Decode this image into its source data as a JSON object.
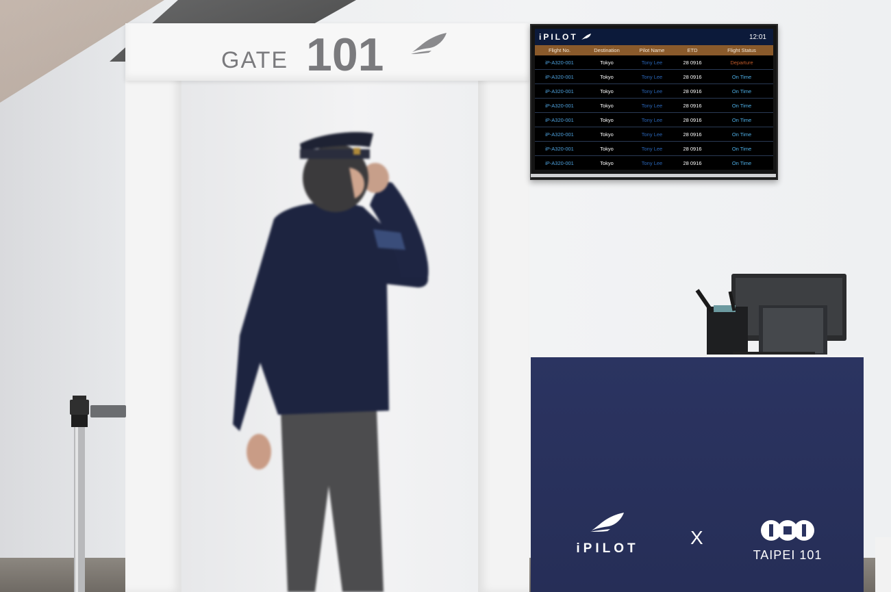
{
  "gate": {
    "word": "GATE",
    "number": "101"
  },
  "board": {
    "brand": "iPILOT",
    "time": "12:01",
    "columns": [
      "Flight No.",
      "Destination",
      "Pilot Name",
      "ETD",
      "Flight Status"
    ],
    "rows": [
      {
        "flight": "iP-A320-001",
        "dest": "Tokyo",
        "pilot": "Tony Lee",
        "etd": "28 0916",
        "status": "Departure"
      },
      {
        "flight": "iP-A320-001",
        "dest": "Tokyo",
        "pilot": "Tony Lee",
        "etd": "28 0916",
        "status": "On Time"
      },
      {
        "flight": "iP-A320-001",
        "dest": "Tokyo",
        "pilot": "Tony Lee",
        "etd": "28 0916",
        "status": "On Time"
      },
      {
        "flight": "iP-A320-001",
        "dest": "Tokyo",
        "pilot": "Tony Lee",
        "etd": "28 0916",
        "status": "On Time"
      },
      {
        "flight": "iP-A320-001",
        "dest": "Tokyo",
        "pilot": "Tony Lee",
        "etd": "28 0916",
        "status": "On Time"
      },
      {
        "flight": "iP-A320-001",
        "dest": "Tokyo",
        "pilot": "Tony Lee",
        "etd": "28 0916",
        "status": "On Time"
      },
      {
        "flight": "iP-A320-001",
        "dest": "Tokyo",
        "pilot": "Tony Lee",
        "etd": "28 0916",
        "status": "On Time"
      },
      {
        "flight": "iP-A320-001",
        "dest": "Tokyo",
        "pilot": "Tony Lee",
        "etd": "28 0916",
        "status": "On Time"
      }
    ]
  },
  "counter": {
    "brand_left": "iPILOT",
    "separator": "X",
    "brand_right": "TAIPEI 101"
  },
  "colors": {
    "counter_navy": "#2a3360",
    "board_header": "#0c1a3a",
    "column_bar": "#8a5a2b",
    "gate_text": "#7a7a7d"
  }
}
